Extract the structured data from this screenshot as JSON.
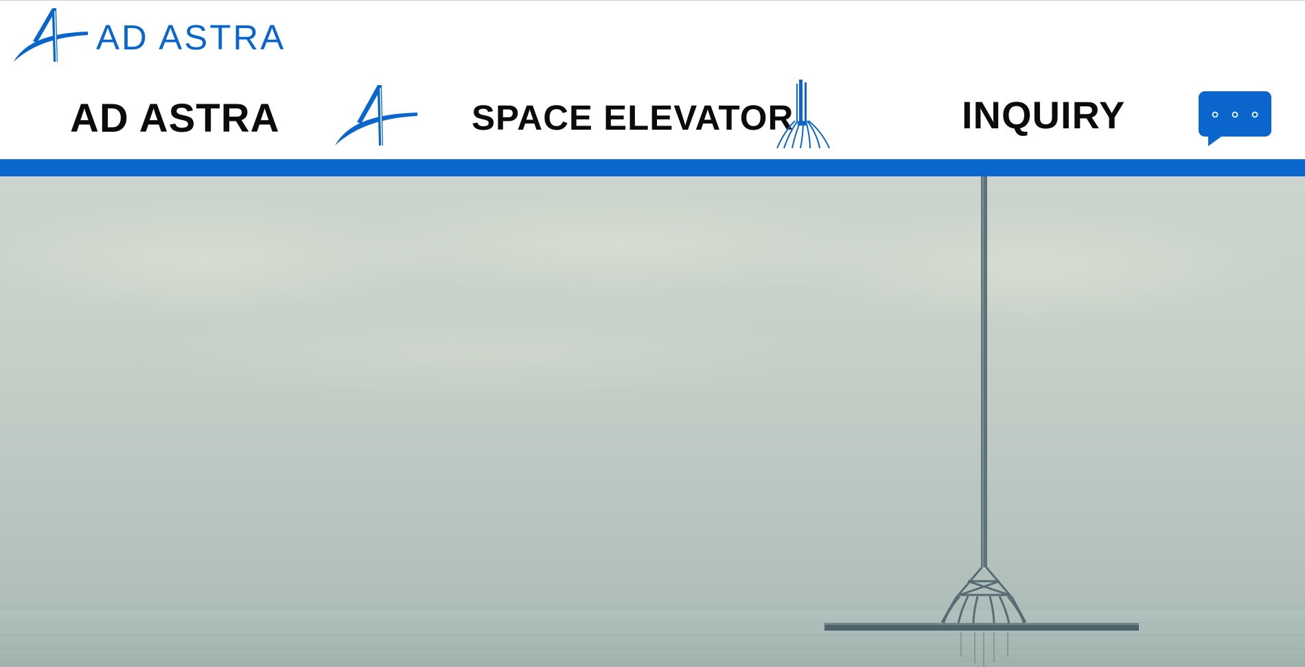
{
  "brand": {
    "name": "AD ASTRA",
    "color": "#0a66cc",
    "logo_icon": "ad-astra-swoosh-icon"
  },
  "nav": {
    "items": [
      {
        "label": "AD ASTRA",
        "icon": "ad-astra-swoosh-icon"
      },
      {
        "label": "SPACE ELEVATOR",
        "icon": "space-elevator-tower-icon"
      },
      {
        "label": "INQUIRY",
        "icon": "chat-bubble-icon"
      }
    ]
  },
  "chat": {
    "icon": "chat-bubble-icon",
    "color": "#0a66cc"
  },
  "theme": {
    "accent_bar": "#0a66cc",
    "sky": "#c4cec6",
    "sea": "#a9b9b5"
  },
  "hero": {
    "image": "space-elevator-tower-over-sea"
  }
}
